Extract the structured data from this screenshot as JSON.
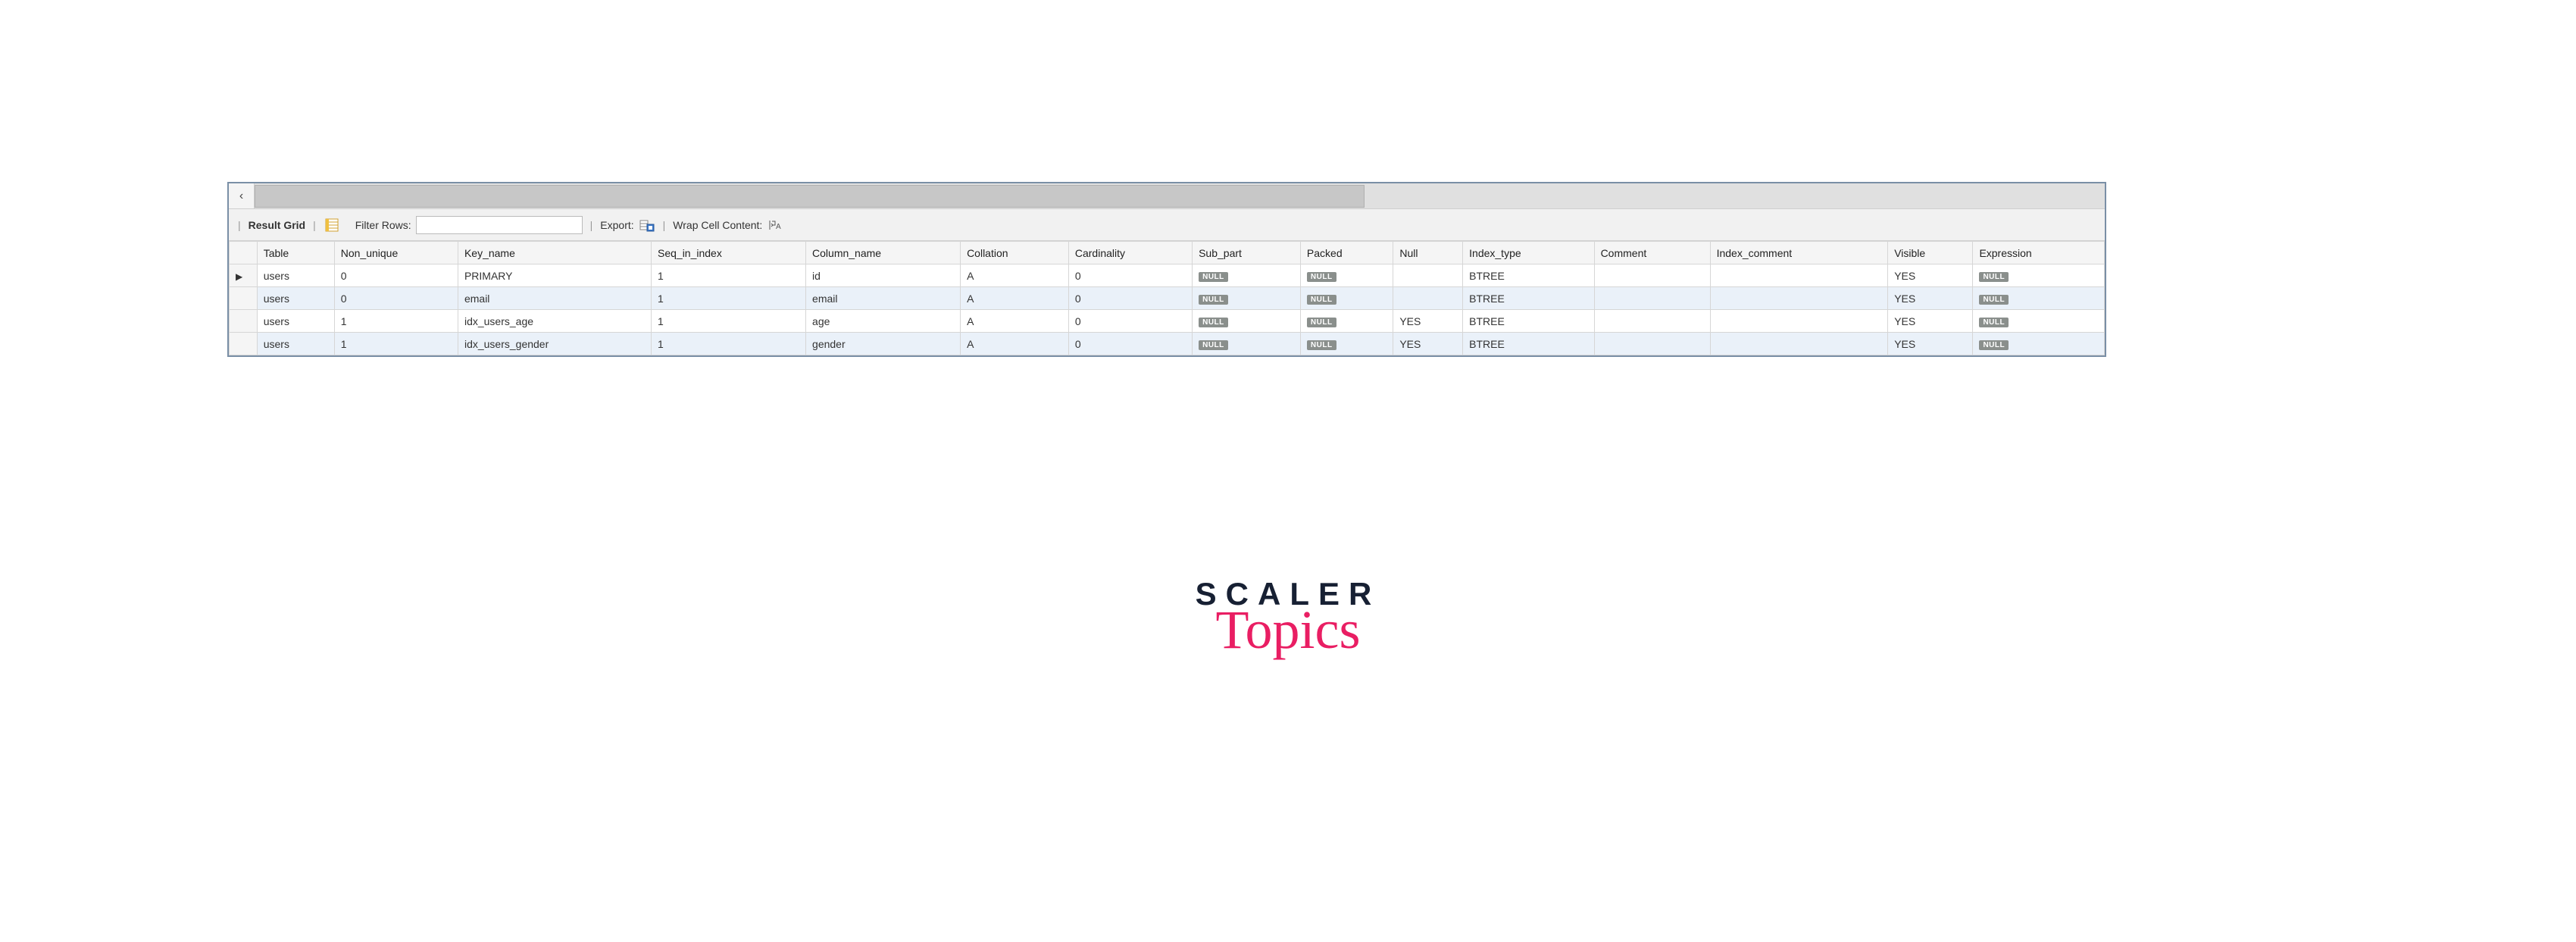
{
  "toolbar": {
    "result_grid_label": "Result Grid",
    "filter_rows_label": "Filter Rows:",
    "filter_rows_value": "",
    "export_label": "Export:",
    "wrap_cell_label": "Wrap Cell Content:"
  },
  "columns": {
    "table": "Table",
    "non_unique": "Non_unique",
    "key_name": "Key_name",
    "seq_in_index": "Seq_in_index",
    "column_name": "Column_name",
    "collation": "Collation",
    "cardinality": "Cardinality",
    "sub_part": "Sub_part",
    "packed": "Packed",
    "null": "Null",
    "index_type": "Index_type",
    "comment": "Comment",
    "index_comment": "Index_comment",
    "visible": "Visible",
    "expression": "Expression"
  },
  "null_badge": "NULL",
  "rows": [
    {
      "current": true,
      "table": "users",
      "non_unique": "0",
      "key_name": "PRIMARY",
      "seq_in_index": "1",
      "column_name": "id",
      "collation": "A",
      "cardinality": "0",
      "sub_part": null,
      "packed": null,
      "null": "",
      "index_type": "BTREE",
      "comment": "",
      "index_comment": "",
      "visible": "YES",
      "expression": null
    },
    {
      "current": false,
      "table": "users",
      "non_unique": "0",
      "key_name": "email",
      "seq_in_index": "1",
      "column_name": "email",
      "collation": "A",
      "cardinality": "0",
      "sub_part": null,
      "packed": null,
      "null": "",
      "index_type": "BTREE",
      "comment": "",
      "index_comment": "",
      "visible": "YES",
      "expression": null
    },
    {
      "current": false,
      "table": "users",
      "non_unique": "1",
      "key_name": "idx_users_age",
      "seq_in_index": "1",
      "column_name": "age",
      "collation": "A",
      "cardinality": "0",
      "sub_part": null,
      "packed": null,
      "null": "YES",
      "index_type": "BTREE",
      "comment": "",
      "index_comment": "",
      "visible": "YES",
      "expression": null
    },
    {
      "current": false,
      "table": "users",
      "non_unique": "1",
      "key_name": "idx_users_gender",
      "seq_in_index": "1",
      "column_name": "gender",
      "collation": "A",
      "cardinality": "0",
      "sub_part": null,
      "packed": null,
      "null": "YES",
      "index_type": "BTREE",
      "comment": "",
      "index_comment": "",
      "visible": "YES",
      "expression": null
    }
  ],
  "logo": {
    "line1": "SCALER",
    "line2": "Topics"
  }
}
